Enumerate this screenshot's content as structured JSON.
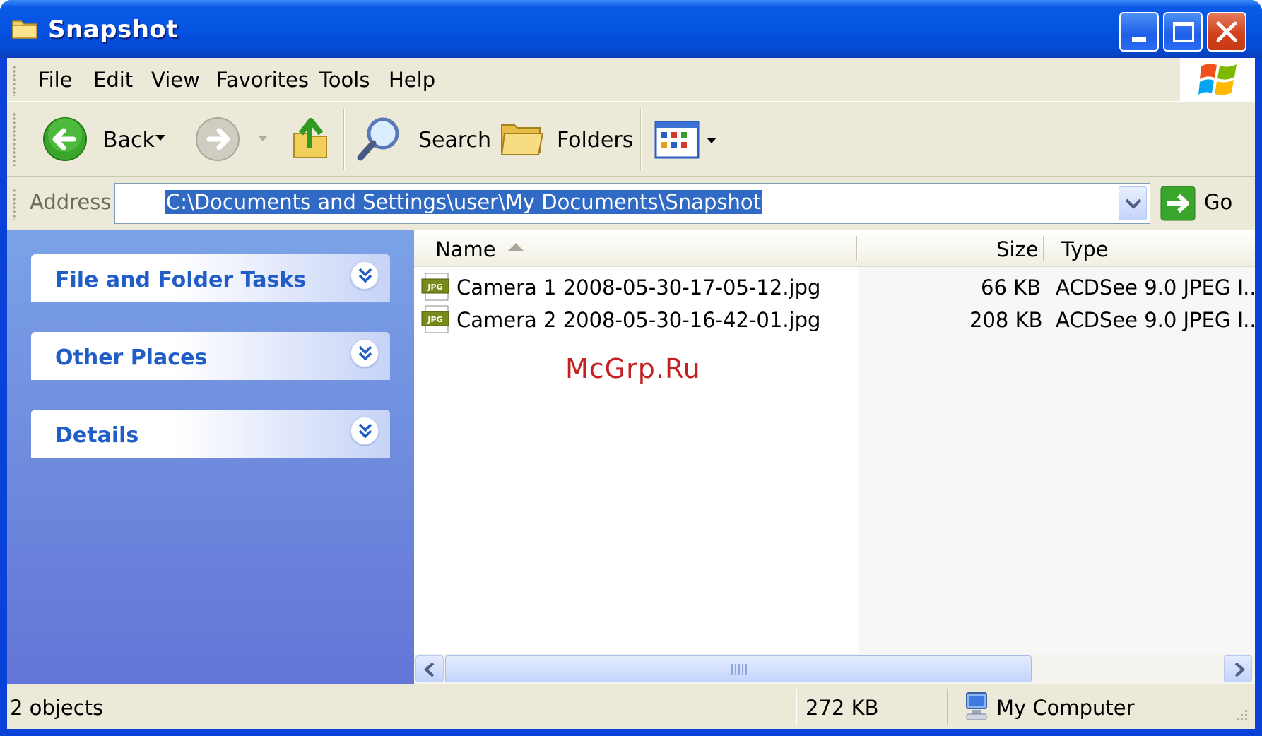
{
  "window": {
    "title": "Snapshot"
  },
  "menu": [
    "File",
    "Edit",
    "View",
    "Favorites",
    "Tools",
    "Help"
  ],
  "toolbar": {
    "back_label": "Back",
    "search_label": "Search",
    "folders_label": "Folders"
  },
  "address": {
    "label": "Address",
    "value": "C:\\Documents and Settings\\user\\My Documents\\Snapshot",
    "go_label": "Go"
  },
  "tasks": {
    "panels": [
      "File and Folder Tasks",
      "Other Places",
      "Details"
    ]
  },
  "columns": {
    "name": "Name",
    "size": "Size",
    "type": "Type"
  },
  "files": [
    {
      "name": "Camera 1 2008-05-30-17-05-12.jpg",
      "size": "66 KB",
      "type": "ACDSee 9.0 JPEG I..",
      "icon": "jpg-file-icon"
    },
    {
      "name": "Camera 2 2008-05-30-16-42-01.jpg",
      "size": "208 KB",
      "type": "ACDSee 9.0 JPEG I..",
      "icon": "jpg-file-icon"
    }
  ],
  "status": {
    "objects": "2 objects",
    "size": "272 KB",
    "location": "My Computer"
  },
  "watermark": "McGrp.Ru",
  "colors": {
    "title_blue": "#0553e1",
    "taskpane_top": "#7ba2e7",
    "taskpane_bottom": "#6375d6",
    "panel_title": "#215dc6",
    "selection": "#316ac5"
  }
}
